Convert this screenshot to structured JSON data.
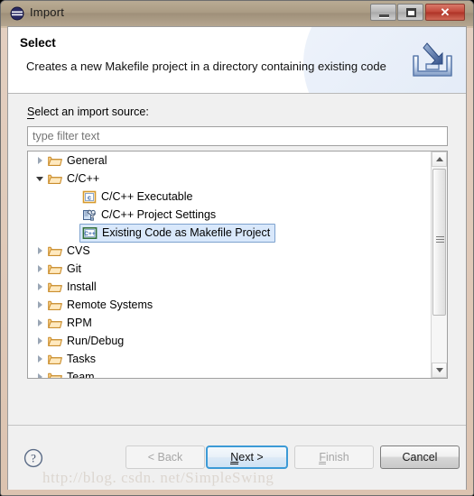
{
  "window": {
    "title": "Import",
    "title_icon": "eclipse-import-icon",
    "controls": {
      "minimize": "minimize-button",
      "maximize": "maximize-button",
      "close": "✕"
    }
  },
  "header": {
    "title": "Select",
    "description": "Creates a new Makefile project in a directory containing existing code",
    "icon": "import-wizard-icon"
  },
  "body": {
    "source_label": "Select an import source:",
    "source_label_mnemonic": "S",
    "filter": {
      "value": "",
      "placeholder": "type filter text"
    },
    "tree": [
      {
        "label": "General",
        "level": 0,
        "icon": "folder-icon",
        "state": "collapsed",
        "selected": false
      },
      {
        "label": "C/C++",
        "level": 0,
        "icon": "folder-icon",
        "state": "expanded",
        "selected": false
      },
      {
        "label": "C/C++ Executable",
        "level": 1,
        "icon": "c-file-icon",
        "state": "leaf",
        "selected": false
      },
      {
        "label": "C/C++ Project Settings",
        "level": 1,
        "icon": "project-settings-icon",
        "state": "leaf",
        "selected": false
      },
      {
        "label": "Existing Code as Makefile Project",
        "level": 1,
        "icon": "cpp-file-icon",
        "state": "leaf",
        "selected": true
      },
      {
        "label": "CVS",
        "level": 0,
        "icon": "folder-icon",
        "state": "collapsed",
        "selected": false
      },
      {
        "label": "Git",
        "level": 0,
        "icon": "folder-icon",
        "state": "collapsed",
        "selected": false
      },
      {
        "label": "Install",
        "level": 0,
        "icon": "folder-icon",
        "state": "collapsed",
        "selected": false
      },
      {
        "label": "Remote Systems",
        "level": 0,
        "icon": "folder-icon",
        "state": "collapsed",
        "selected": false
      },
      {
        "label": "RPM",
        "level": 0,
        "icon": "folder-icon",
        "state": "collapsed",
        "selected": false
      },
      {
        "label": "Run/Debug",
        "level": 0,
        "icon": "folder-icon",
        "state": "collapsed",
        "selected": false
      },
      {
        "label": "Tasks",
        "level": 0,
        "icon": "folder-icon",
        "state": "collapsed",
        "selected": false
      },
      {
        "label": "Team",
        "level": 0,
        "icon": "folder-icon",
        "state": "collapsed",
        "selected": false
      }
    ],
    "scrollbar": {
      "up": "▲",
      "down": "▼"
    }
  },
  "footer": {
    "help": "?",
    "back": {
      "label": "< Back",
      "mnemonic": "B",
      "enabled": false,
      "focused": false
    },
    "next": {
      "label": "Next >",
      "mnemonic": "N",
      "enabled": true,
      "focused": true
    },
    "finish": {
      "label": "Finish",
      "mnemonic": "F",
      "enabled": false,
      "focused": false
    },
    "cancel": {
      "label": "Cancel",
      "mnemonic": "",
      "enabled": true,
      "focused": false
    }
  },
  "watermark": "http://blog. csdn. net/SimpleSwing",
  "colors": {
    "window_border": "#d8c7b1",
    "titlebar": "#a99a83",
    "close_button": "#c2483a",
    "selection_bg": "#d9e8fb",
    "selection_border": "#7da2ce",
    "focus_ring": "#3c9ad6",
    "folder_icon": "#f0ad4a"
  }
}
